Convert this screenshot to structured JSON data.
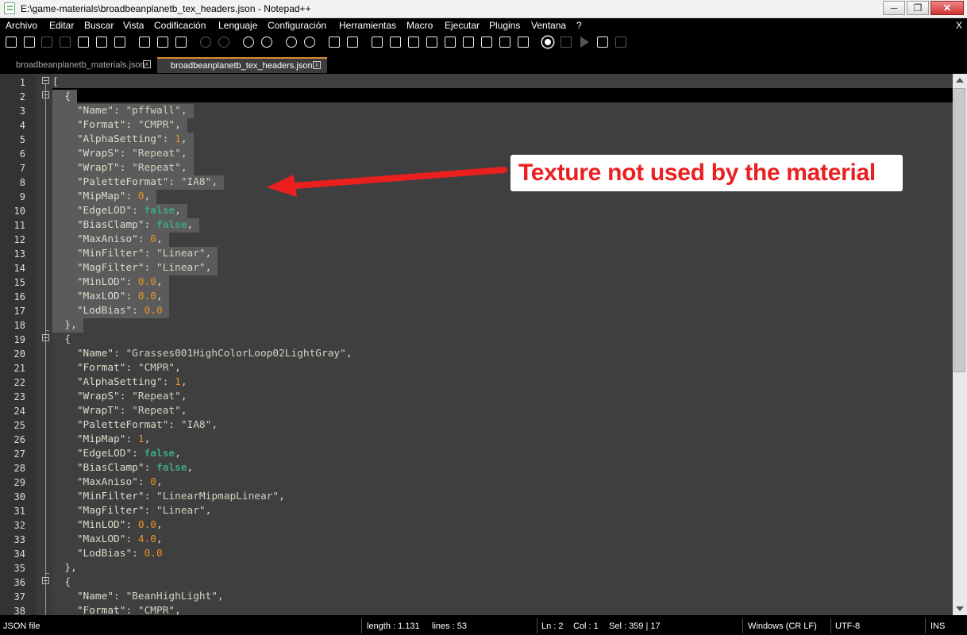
{
  "window": {
    "title": "E:\\game-materials\\broadbeanplanetb_tex_headers.json - Notepad++",
    "minimize": "─",
    "maximize": "❐",
    "close": "✕"
  },
  "menu": {
    "items": [
      "Archivo",
      "Editar",
      "Buscar",
      "Vista",
      "Codificación",
      "Lenguaje",
      "Configuración",
      "Herramientas",
      "Macro",
      "Ejecutar",
      "Plugins",
      "Ventana",
      "?"
    ],
    "close_doc": "X"
  },
  "tabs": [
    {
      "label": "broadbeanplanetb_materials.json",
      "close": "x",
      "active": false
    },
    {
      "label": "broadbeanplanetb_tex_headers.json",
      "close": "x",
      "active": true
    }
  ],
  "code_lines": [
    "1",
    "2",
    "3",
    "4",
    "5",
    "6",
    "7",
    "8",
    "9",
    "10",
    "11",
    "12",
    "13",
    "14",
    "15",
    "16",
    "17",
    "18",
    "19",
    "20",
    "21",
    "22",
    "23",
    "24",
    "25",
    "26",
    "27",
    "28",
    "29",
    "30",
    "31",
    "32",
    "33",
    "34",
    "35",
    "36",
    "37",
    "38"
  ],
  "code": [
    [
      {
        "t": "p",
        "v": "["
      }
    ],
    [
      {
        "t": "p",
        "v": "  {"
      }
    ],
    [
      {
        "t": "k",
        "v": "    \"Name\""
      },
      {
        "t": "p",
        "v": ": "
      },
      {
        "t": "s",
        "v": "\"pffwall\""
      },
      {
        "t": "p",
        "v": ","
      }
    ],
    [
      {
        "t": "k",
        "v": "    \"Format\""
      },
      {
        "t": "p",
        "v": ": "
      },
      {
        "t": "s",
        "v": "\"CMPR\""
      },
      {
        "t": "p",
        "v": ","
      }
    ],
    [
      {
        "t": "k",
        "v": "    \"AlphaSetting\""
      },
      {
        "t": "p",
        "v": ": "
      },
      {
        "t": "n",
        "v": "1"
      },
      {
        "t": "p",
        "v": ","
      }
    ],
    [
      {
        "t": "k",
        "v": "    \"WrapS\""
      },
      {
        "t": "p",
        "v": ": "
      },
      {
        "t": "s",
        "v": "\"Repeat\""
      },
      {
        "t": "p",
        "v": ","
      }
    ],
    [
      {
        "t": "k",
        "v": "    \"WrapT\""
      },
      {
        "t": "p",
        "v": ": "
      },
      {
        "t": "s",
        "v": "\"Repeat\""
      },
      {
        "t": "p",
        "v": ","
      }
    ],
    [
      {
        "t": "k",
        "v": "    \"PaletteFormat\""
      },
      {
        "t": "p",
        "v": ": "
      },
      {
        "t": "s",
        "v": "\"IA8\""
      },
      {
        "t": "p",
        "v": ","
      }
    ],
    [
      {
        "t": "k",
        "v": "    \"MipMap\""
      },
      {
        "t": "p",
        "v": ": "
      },
      {
        "t": "n",
        "v": "0"
      },
      {
        "t": "p",
        "v": ","
      }
    ],
    [
      {
        "t": "k",
        "v": "    \"EdgeLOD\""
      },
      {
        "t": "p",
        "v": ": "
      },
      {
        "t": "b",
        "v": "false"
      },
      {
        "t": "p",
        "v": ","
      }
    ],
    [
      {
        "t": "k",
        "v": "    \"BiasClamp\""
      },
      {
        "t": "p",
        "v": ": "
      },
      {
        "t": "b",
        "v": "false"
      },
      {
        "t": "p",
        "v": ","
      }
    ],
    [
      {
        "t": "k",
        "v": "    \"MaxAniso\""
      },
      {
        "t": "p",
        "v": ": "
      },
      {
        "t": "n",
        "v": "0"
      },
      {
        "t": "p",
        "v": ","
      }
    ],
    [
      {
        "t": "k",
        "v": "    \"MinFilter\""
      },
      {
        "t": "p",
        "v": ": "
      },
      {
        "t": "s",
        "v": "\"Linear\""
      },
      {
        "t": "p",
        "v": ","
      }
    ],
    [
      {
        "t": "k",
        "v": "    \"MagFilter\""
      },
      {
        "t": "p",
        "v": ": "
      },
      {
        "t": "s",
        "v": "\"Linear\""
      },
      {
        "t": "p",
        "v": ","
      }
    ],
    [
      {
        "t": "k",
        "v": "    \"MinLOD\""
      },
      {
        "t": "p",
        "v": ": "
      },
      {
        "t": "n",
        "v": "0.0"
      },
      {
        "t": "p",
        "v": ","
      }
    ],
    [
      {
        "t": "k",
        "v": "    \"MaxLOD\""
      },
      {
        "t": "p",
        "v": ": "
      },
      {
        "t": "n",
        "v": "0.0"
      },
      {
        "t": "p",
        "v": ","
      }
    ],
    [
      {
        "t": "k",
        "v": "    \"LodBias\""
      },
      {
        "t": "p",
        "v": ": "
      },
      {
        "t": "n",
        "v": "0.0"
      }
    ],
    [
      {
        "t": "p",
        "v": "  },"
      }
    ],
    [
      {
        "t": "p",
        "v": "  {"
      }
    ],
    [
      {
        "t": "k",
        "v": "    \"Name\""
      },
      {
        "t": "p",
        "v": ": "
      },
      {
        "t": "s",
        "v": "\"Grasses001HighColorLoop02LightGray\""
      },
      {
        "t": "p",
        "v": ","
      }
    ],
    [
      {
        "t": "k",
        "v": "    \"Format\""
      },
      {
        "t": "p",
        "v": ": "
      },
      {
        "t": "s",
        "v": "\"CMPR\""
      },
      {
        "t": "p",
        "v": ","
      }
    ],
    [
      {
        "t": "k",
        "v": "    \"AlphaSetting\""
      },
      {
        "t": "p",
        "v": ": "
      },
      {
        "t": "n",
        "v": "1"
      },
      {
        "t": "p",
        "v": ","
      }
    ],
    [
      {
        "t": "k",
        "v": "    \"WrapS\""
      },
      {
        "t": "p",
        "v": ": "
      },
      {
        "t": "s",
        "v": "\"Repeat\""
      },
      {
        "t": "p",
        "v": ","
      }
    ],
    [
      {
        "t": "k",
        "v": "    \"WrapT\""
      },
      {
        "t": "p",
        "v": ": "
      },
      {
        "t": "s",
        "v": "\"Repeat\""
      },
      {
        "t": "p",
        "v": ","
      }
    ],
    [
      {
        "t": "k",
        "v": "    \"PaletteFormat\""
      },
      {
        "t": "p",
        "v": ": "
      },
      {
        "t": "s",
        "v": "\"IA8\""
      },
      {
        "t": "p",
        "v": ","
      }
    ],
    [
      {
        "t": "k",
        "v": "    \"MipMap\""
      },
      {
        "t": "p",
        "v": ": "
      },
      {
        "t": "n",
        "v": "1"
      },
      {
        "t": "p",
        "v": ","
      }
    ],
    [
      {
        "t": "k",
        "v": "    \"EdgeLOD\""
      },
      {
        "t": "p",
        "v": ": "
      },
      {
        "t": "b",
        "v": "false"
      },
      {
        "t": "p",
        "v": ","
      }
    ],
    [
      {
        "t": "k",
        "v": "    \"BiasClamp\""
      },
      {
        "t": "p",
        "v": ": "
      },
      {
        "t": "b",
        "v": "false"
      },
      {
        "t": "p",
        "v": ","
      }
    ],
    [
      {
        "t": "k",
        "v": "    \"MaxAniso\""
      },
      {
        "t": "p",
        "v": ": "
      },
      {
        "t": "n",
        "v": "0"
      },
      {
        "t": "p",
        "v": ","
      }
    ],
    [
      {
        "t": "k",
        "v": "    \"MinFilter\""
      },
      {
        "t": "p",
        "v": ": "
      },
      {
        "t": "s",
        "v": "\"LinearMipmapLinear\""
      },
      {
        "t": "p",
        "v": ","
      }
    ],
    [
      {
        "t": "k",
        "v": "    \"MagFilter\""
      },
      {
        "t": "p",
        "v": ": "
      },
      {
        "t": "s",
        "v": "\"Linear\""
      },
      {
        "t": "p",
        "v": ","
      }
    ],
    [
      {
        "t": "k",
        "v": "    \"MinLOD\""
      },
      {
        "t": "p",
        "v": ": "
      },
      {
        "t": "n",
        "v": "0.0"
      },
      {
        "t": "p",
        "v": ","
      }
    ],
    [
      {
        "t": "k",
        "v": "    \"MaxLOD\""
      },
      {
        "t": "p",
        "v": ": "
      },
      {
        "t": "n",
        "v": "4.0"
      },
      {
        "t": "p",
        "v": ","
      }
    ],
    [
      {
        "t": "k",
        "v": "    \"LodBias\""
      },
      {
        "t": "p",
        "v": ": "
      },
      {
        "t": "n",
        "v": "0.0"
      }
    ],
    [
      {
        "t": "p",
        "v": "  },"
      }
    ],
    [
      {
        "t": "p",
        "v": "  {"
      }
    ],
    [
      {
        "t": "k",
        "v": "    \"Name\""
      },
      {
        "t": "p",
        "v": ": "
      },
      {
        "t": "s",
        "v": "\"BeanHighLight\""
      },
      {
        "t": "p",
        "v": ","
      }
    ],
    [
      {
        "t": "k",
        "v": "    \"Format\""
      },
      {
        "t": "p",
        "v": ": "
      },
      {
        "t": "s",
        "v": "\"CMPR\""
      },
      {
        "t": "p",
        "v": ","
      }
    ]
  ],
  "annotation": {
    "text": "Texture not used by the material",
    "color": "#ea1f1f"
  },
  "status": {
    "file_type": "JSON file",
    "length": "length : 1.131",
    "lines": "lines : 53",
    "ln": "Ln : 2",
    "col": "Col : 1",
    "sel": "Sel : 359 | 17",
    "eol": "Windows (CR LF)",
    "encoding": "UTF-8",
    "mode": "INS"
  },
  "colors": {
    "editor_bg": "#3f3f3f",
    "number": "#e8922c",
    "boolean": "#3fa67f",
    "tab_accent": "#d98c2b"
  }
}
